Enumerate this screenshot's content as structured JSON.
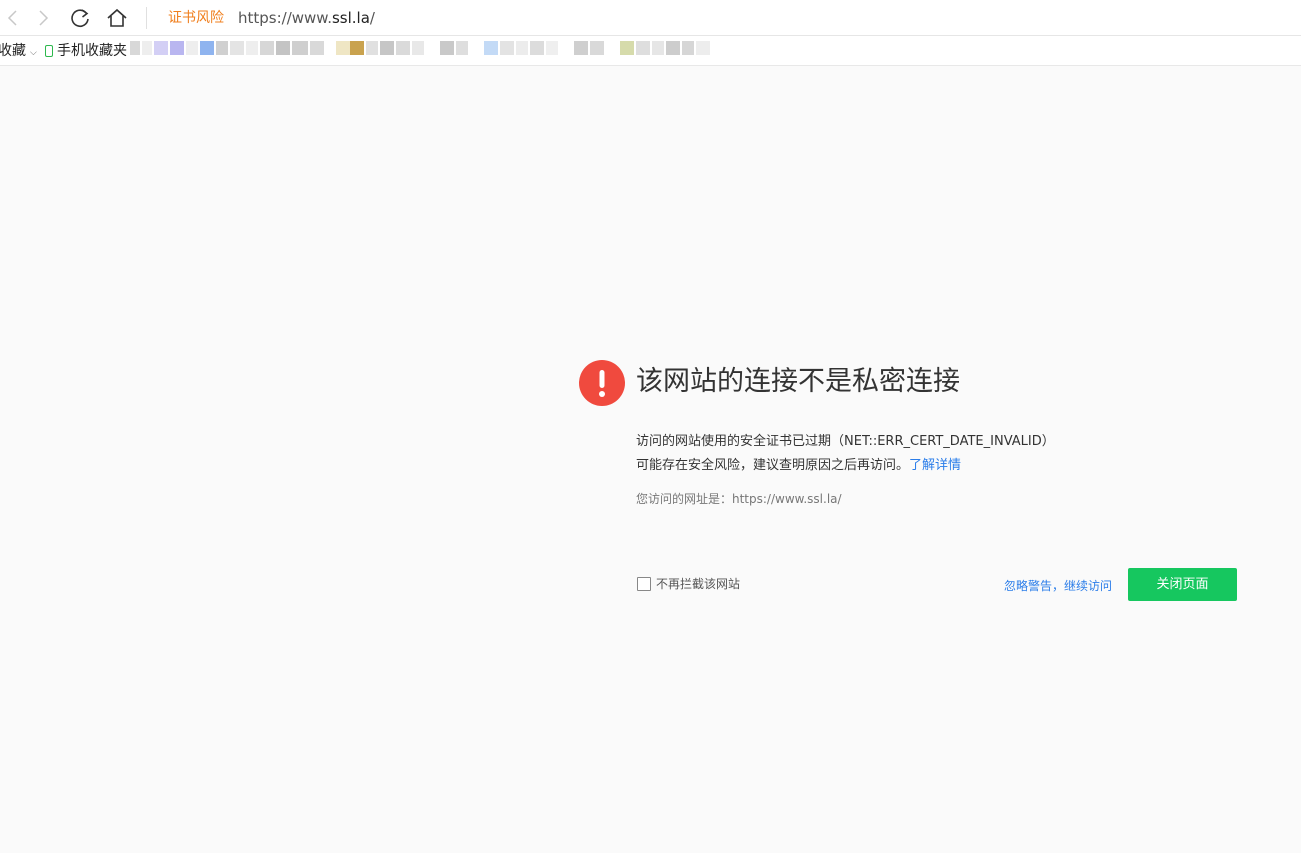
{
  "toolbar": {
    "back_icon": "chevron-left-icon",
    "forward_icon": "chevron-right-icon",
    "reload_icon": "reload-icon",
    "home_icon": "home-icon",
    "risk_label": "证书风险",
    "url_prefix": "https://www.",
    "url_host": "ssl.la",
    "url_suffix": "/"
  },
  "bookmarks": {
    "favorites_label": "收藏",
    "favorites_chevron": "⌵",
    "mobile_label": "手机收藏夹"
  },
  "main": {
    "headline": "该网站的连接不是私密连接",
    "line1": "访问的网站使用的安全证书已过期（NET::ERR_CERT_DATE_INVALID）",
    "line2": "可能存在安全风险，建议查明原因之后再访问。",
    "learn_more": "了解详情",
    "visited_url": "您访问的网址是：https://www.ssl.la/",
    "no_block_label": "不再拦截该网站",
    "no_block_checked": false,
    "continue_link": "忽略警告，继续访问",
    "close_button": "关闭页面"
  },
  "colors": {
    "accent_green": "#16c75f",
    "warning_red": "#f04a3e",
    "risk_orange": "#f07f1e",
    "link_blue": "#2b7de9"
  }
}
